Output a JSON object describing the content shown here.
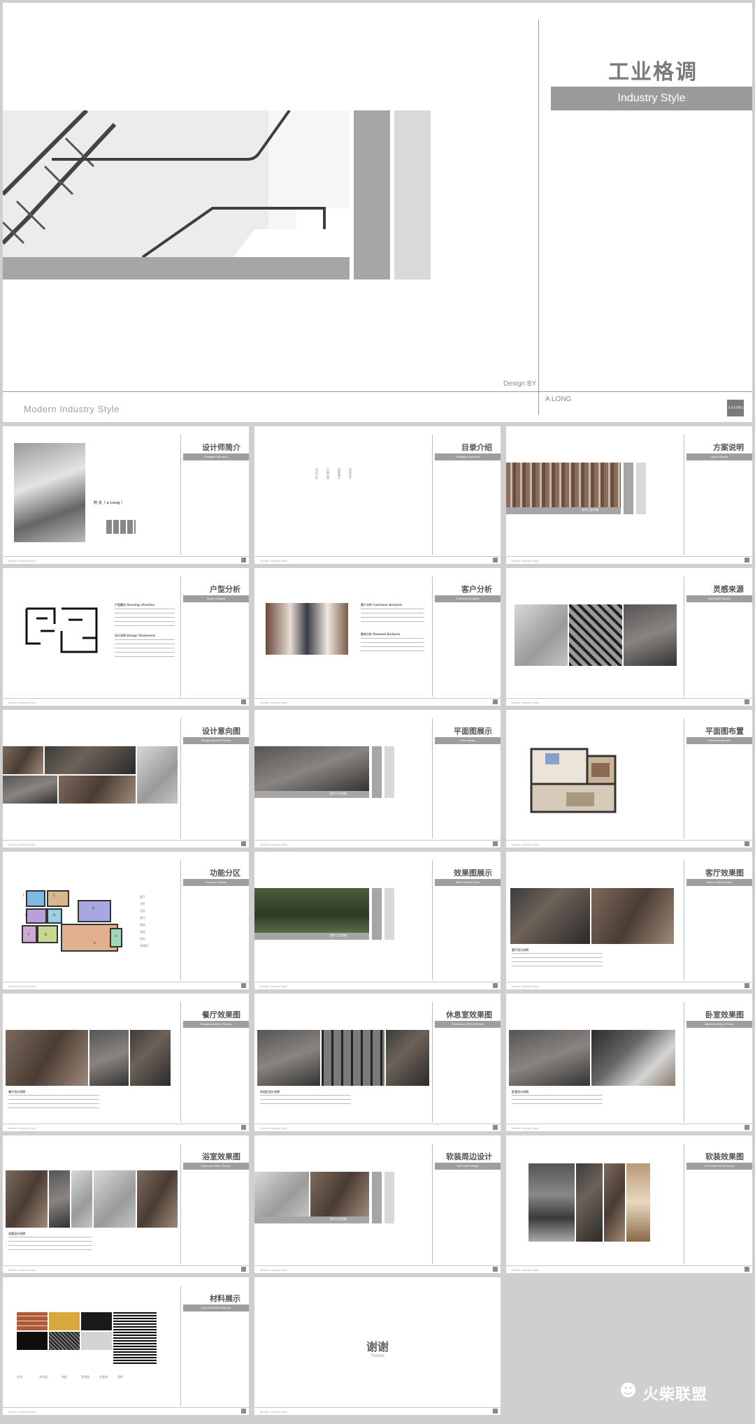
{
  "cover": {
    "title": "工业格调",
    "title_en": "Industry Style",
    "design_by": "Design  BY",
    "author": "A  LONG",
    "subtitle": "Modern  Industry Style",
    "logo": "A LONG"
  },
  "slides": [
    {
      "title": "设计师简介",
      "band": "Designer Introduct",
      "name": "阿 龙（ a Long ）"
    },
    {
      "title": "目录介绍",
      "band": "Catalogue  Introduct",
      "toc": [
        "项目分析",
        "平面方案",
        "效果展示",
        "软装设计"
      ]
    },
    {
      "title": "方案说明",
      "band": "Layout Space",
      "caption": "现代工业风格"
    },
    {
      "title": "户型分析",
      "band": "Space  Analysis",
      "notes": [
        "户型概况 Housing situation",
        "设计说明 Design Statement"
      ]
    },
    {
      "title": "客户分析",
      "band": "Customer  Analysis",
      "notes": [
        "客户分析 Customer Analysis",
        "需求分析 Demand Analysis"
      ]
    },
    {
      "title": "灵感来源",
      "band": "Inspiration  Source"
    },
    {
      "title": "设计意向图",
      "band": "Design  Intention  Picture"
    },
    {
      "title": "平面图展示",
      "band": "Plan  display",
      "caption": "现代工业风格"
    },
    {
      "title": "平面图布置",
      "band": "Plan Arrangement"
    },
    {
      "title": "功能分区",
      "band": "Function  Division",
      "legend": [
        "客厅",
        "主卧",
        "次卧",
        "餐厅",
        "厨房",
        "浴室",
        "阳台",
        "衣帽间"
      ],
      "zones": [
        "I",
        "C",
        "B",
        "E",
        "H",
        "F",
        "D",
        "A",
        "H"
      ]
    },
    {
      "title": "效果图展示",
      "band": "Effect  Picture  Show",
      "caption": "现代工业风格"
    },
    {
      "title": "客厅效果图",
      "band": "Saloon Effect  Picture",
      "note": "客厅设计说明"
    },
    {
      "title": "餐厅效果图",
      "band": "Restaurant Effect  Picture",
      "note": "餐厅设计说明"
    },
    {
      "title": "休息室效果图",
      "band": "Rest Room  Effect  Picture",
      "note": "休闲区设计说明"
    },
    {
      "title": "卧室效果图",
      "band": "Bedroom Effect  Picture",
      "note": "卧室设计说明"
    },
    {
      "title": "浴室效果图",
      "band": "Bathroom Effect  Picture",
      "note": "浴室设计说明"
    },
    {
      "title": "软装周边设计",
      "band": "Soft  Outfit  Design",
      "caption": "现代工业风格"
    },
    {
      "title": "软装效果图",
      "band": "Soft  Outfit  Effect  Picture"
    },
    {
      "title": "材料展示",
      "band": "Soft  Outfit  Effect  Picture",
      "materials": [
        "红砖",
        "木饰面",
        "地板",
        "黑胡桃",
        "乳胶漆",
        "墙纸"
      ]
    }
  ],
  "footer_text": "Modern  Industry Style",
  "thanks": {
    "title": "谢谢",
    "subtitle": "Thanks"
  },
  "watermark": "火柴联盟"
}
